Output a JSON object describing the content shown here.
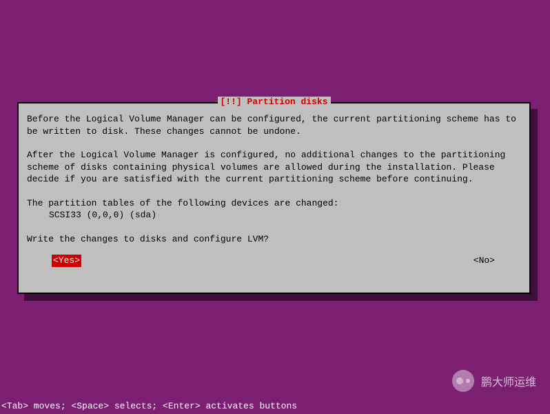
{
  "dialog": {
    "title": "[!!] Partition disks",
    "para1": "Before the Logical Volume Manager can be configured, the current partitioning scheme has to be written to disk. These changes cannot be undone.",
    "para2": "After the Logical Volume Manager is configured, no additional changes to the partitioning scheme of disks containing physical volumes are allowed during the installation. Please decide if you are satisfied with the current partitioning scheme before continuing.",
    "devices_intro": "The partition tables of the following devices are changed:",
    "device1": "SCSI33 (0,0,0) (sda)",
    "question": "Write the changes to disks and configure LVM?",
    "yes_label": "<Yes>",
    "no_label": "<No>"
  },
  "bottom_hint": "<Tab> moves; <Space> selects; <Enter> activates buttons",
  "watermark": {
    "text": "鹏大师运维"
  }
}
